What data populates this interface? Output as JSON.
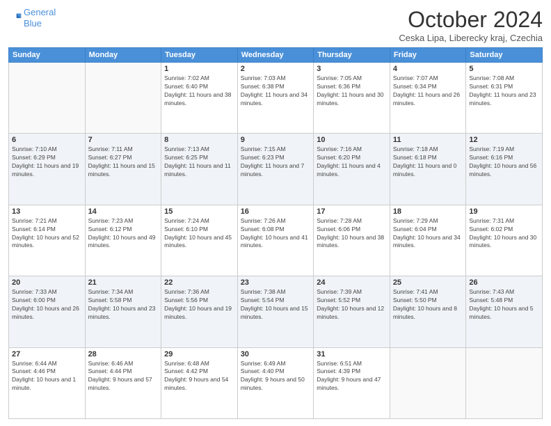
{
  "header": {
    "logo_line1": "General",
    "logo_line2": "Blue",
    "title": "October 2024",
    "subtitle": "Ceska Lipa, Liberecky kraj, Czechia"
  },
  "days_of_week": [
    "Sunday",
    "Monday",
    "Tuesday",
    "Wednesday",
    "Thursday",
    "Friday",
    "Saturday"
  ],
  "weeks": [
    [
      {
        "day": "",
        "detail": ""
      },
      {
        "day": "",
        "detail": ""
      },
      {
        "day": "1",
        "detail": "Sunrise: 7:02 AM\nSunset: 6:40 PM\nDaylight: 11 hours and 38 minutes."
      },
      {
        "day": "2",
        "detail": "Sunrise: 7:03 AM\nSunset: 6:38 PM\nDaylight: 11 hours and 34 minutes."
      },
      {
        "day": "3",
        "detail": "Sunrise: 7:05 AM\nSunset: 6:36 PM\nDaylight: 11 hours and 30 minutes."
      },
      {
        "day": "4",
        "detail": "Sunrise: 7:07 AM\nSunset: 6:34 PM\nDaylight: 11 hours and 26 minutes."
      },
      {
        "day": "5",
        "detail": "Sunrise: 7:08 AM\nSunset: 6:31 PM\nDaylight: 11 hours and 23 minutes."
      }
    ],
    [
      {
        "day": "6",
        "detail": "Sunrise: 7:10 AM\nSunset: 6:29 PM\nDaylight: 11 hours and 19 minutes."
      },
      {
        "day": "7",
        "detail": "Sunrise: 7:11 AM\nSunset: 6:27 PM\nDaylight: 11 hours and 15 minutes."
      },
      {
        "day": "8",
        "detail": "Sunrise: 7:13 AM\nSunset: 6:25 PM\nDaylight: 11 hours and 11 minutes."
      },
      {
        "day": "9",
        "detail": "Sunrise: 7:15 AM\nSunset: 6:23 PM\nDaylight: 11 hours and 7 minutes."
      },
      {
        "day": "10",
        "detail": "Sunrise: 7:16 AM\nSunset: 6:20 PM\nDaylight: 11 hours and 4 minutes."
      },
      {
        "day": "11",
        "detail": "Sunrise: 7:18 AM\nSunset: 6:18 PM\nDaylight: 11 hours and 0 minutes."
      },
      {
        "day": "12",
        "detail": "Sunrise: 7:19 AM\nSunset: 6:16 PM\nDaylight: 10 hours and 56 minutes."
      }
    ],
    [
      {
        "day": "13",
        "detail": "Sunrise: 7:21 AM\nSunset: 6:14 PM\nDaylight: 10 hours and 52 minutes."
      },
      {
        "day": "14",
        "detail": "Sunrise: 7:23 AM\nSunset: 6:12 PM\nDaylight: 10 hours and 49 minutes."
      },
      {
        "day": "15",
        "detail": "Sunrise: 7:24 AM\nSunset: 6:10 PM\nDaylight: 10 hours and 45 minutes."
      },
      {
        "day": "16",
        "detail": "Sunrise: 7:26 AM\nSunset: 6:08 PM\nDaylight: 10 hours and 41 minutes."
      },
      {
        "day": "17",
        "detail": "Sunrise: 7:28 AM\nSunset: 6:06 PM\nDaylight: 10 hours and 38 minutes."
      },
      {
        "day": "18",
        "detail": "Sunrise: 7:29 AM\nSunset: 6:04 PM\nDaylight: 10 hours and 34 minutes."
      },
      {
        "day": "19",
        "detail": "Sunrise: 7:31 AM\nSunset: 6:02 PM\nDaylight: 10 hours and 30 minutes."
      }
    ],
    [
      {
        "day": "20",
        "detail": "Sunrise: 7:33 AM\nSunset: 6:00 PM\nDaylight: 10 hours and 26 minutes."
      },
      {
        "day": "21",
        "detail": "Sunrise: 7:34 AM\nSunset: 5:58 PM\nDaylight: 10 hours and 23 minutes."
      },
      {
        "day": "22",
        "detail": "Sunrise: 7:36 AM\nSunset: 5:56 PM\nDaylight: 10 hours and 19 minutes."
      },
      {
        "day": "23",
        "detail": "Sunrise: 7:38 AM\nSunset: 5:54 PM\nDaylight: 10 hours and 15 minutes."
      },
      {
        "day": "24",
        "detail": "Sunrise: 7:39 AM\nSunset: 5:52 PM\nDaylight: 10 hours and 12 minutes."
      },
      {
        "day": "25",
        "detail": "Sunrise: 7:41 AM\nSunset: 5:50 PM\nDaylight: 10 hours and 8 minutes."
      },
      {
        "day": "26",
        "detail": "Sunrise: 7:43 AM\nSunset: 5:48 PM\nDaylight: 10 hours and 5 minutes."
      }
    ],
    [
      {
        "day": "27",
        "detail": "Sunrise: 6:44 AM\nSunset: 4:46 PM\nDaylight: 10 hours and 1 minute."
      },
      {
        "day": "28",
        "detail": "Sunrise: 6:46 AM\nSunset: 4:44 PM\nDaylight: 9 hours and 57 minutes."
      },
      {
        "day": "29",
        "detail": "Sunrise: 6:48 AM\nSunset: 4:42 PM\nDaylight: 9 hours and 54 minutes."
      },
      {
        "day": "30",
        "detail": "Sunrise: 6:49 AM\nSunset: 4:40 PM\nDaylight: 9 hours and 50 minutes."
      },
      {
        "day": "31",
        "detail": "Sunrise: 6:51 AM\nSunset: 4:39 PM\nDaylight: 9 hours and 47 minutes."
      },
      {
        "day": "",
        "detail": ""
      },
      {
        "day": "",
        "detail": ""
      }
    ]
  ]
}
